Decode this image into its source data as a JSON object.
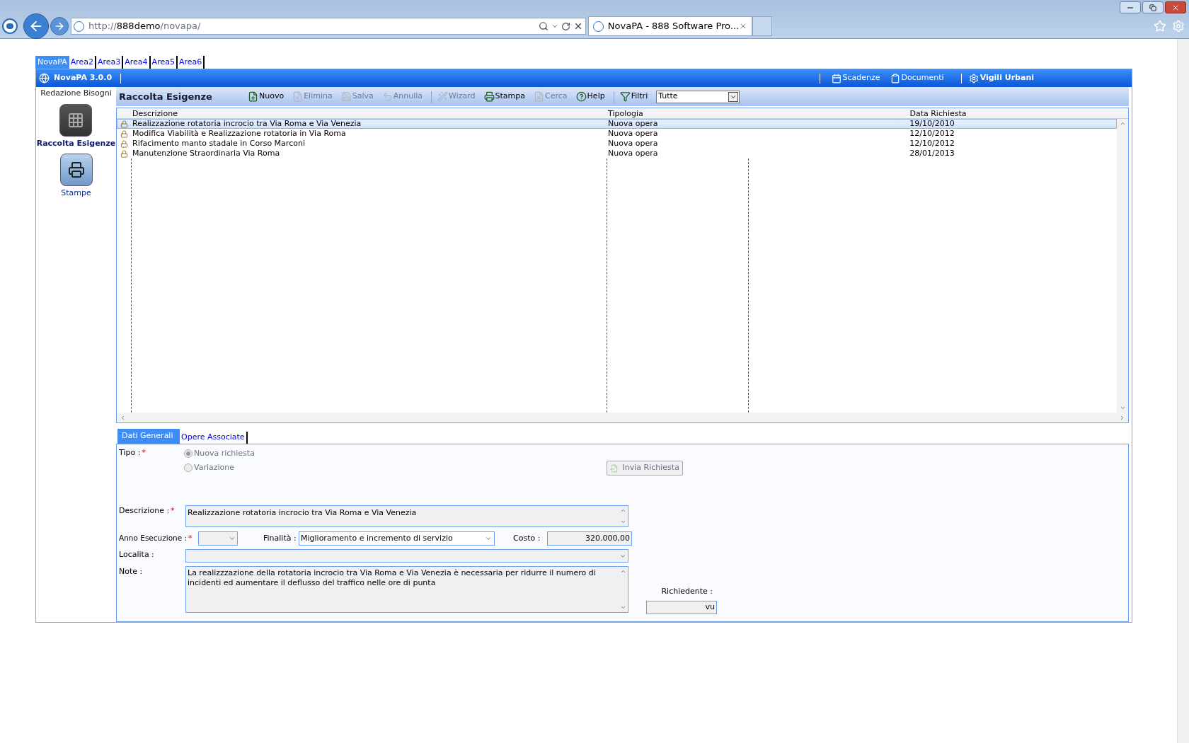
{
  "browser": {
    "url_scheme": "http://",
    "url_host": "888demo",
    "url_path": "/novapa/",
    "tab_title": "NovaPA - 888 Software Pro..."
  },
  "area_tabs": [
    {
      "label": "NovaPA",
      "selected": true
    },
    {
      "label": "Area2",
      "selected": false
    },
    {
      "label": "Area3",
      "selected": false
    },
    {
      "label": "Area4",
      "selected": false
    },
    {
      "label": "Area5",
      "selected": false
    },
    {
      "label": "Area6",
      "selected": false
    }
  ],
  "header": {
    "title": "NovaPA 3.0.0",
    "links": [
      {
        "label": "Scadenze",
        "kind": "calendar",
        "emphasized": false
      },
      {
        "label": "Documenti",
        "kind": "clipboard",
        "emphasized": false
      },
      {
        "label": "Vigili Urbani",
        "kind": "gear",
        "emphasized": true
      }
    ]
  },
  "sidebar": {
    "section_title": "Redazione Bisogni",
    "items": [
      {
        "label": "Raccolta Esigenze",
        "kind": "grid",
        "selected": true
      },
      {
        "label": "Stampe",
        "kind": "printer",
        "selected": false
      }
    ]
  },
  "toolbar": {
    "title": "Raccolta Esigenze",
    "buttons": [
      {
        "label": "Nuovo",
        "kind": "new",
        "disabled": false,
        "separator_after": false
      },
      {
        "label": "Elimina",
        "kind": "delete",
        "disabled": true,
        "separator_after": false
      },
      {
        "label": "Salva",
        "kind": "save",
        "disabled": true,
        "separator_after": false
      },
      {
        "label": "Annulla",
        "kind": "undo",
        "disabled": true,
        "separator_after": true
      },
      {
        "label": "Wizard",
        "kind": "wizard",
        "disabled": true,
        "separator_after": false
      },
      {
        "label": "Stampa",
        "kind": "print",
        "disabled": false,
        "separator_after": false
      },
      {
        "label": "Cerca",
        "kind": "search",
        "disabled": true,
        "separator_after": false
      },
      {
        "label": "Help",
        "kind": "help",
        "disabled": false,
        "separator_after": true
      },
      {
        "label": "Filtri",
        "kind": "filter",
        "disabled": false,
        "separator_after": false
      }
    ],
    "filter": {
      "value": "Tutte"
    }
  },
  "table": {
    "columns": [
      "Descrizione",
      "Tipologia",
      "Data Richiesta"
    ],
    "rows": [
      {
        "cells": [
          "Realizzazione rotatoria incrocio tra Via Roma e Via Venezia",
          "Nuova opera",
          "19/10/2010"
        ],
        "selected": true
      },
      {
        "cells": [
          "Modifica Viabilità e Realizzazione rotatoria in Via Roma",
          "Nuova opera",
          "12/10/2012"
        ],
        "selected": false
      },
      {
        "cells": [
          "Rifacimento manto stadale in Corso Marconi",
          "Nuova opera",
          "12/10/2012"
        ],
        "selected": false
      },
      {
        "cells": [
          "Manutenzione Straordinaria Via Roma",
          "Nuova opera",
          "28/01/2013"
        ],
        "selected": false
      }
    ]
  },
  "detail_tabs": [
    {
      "label": "Dati Generali",
      "selected": true
    },
    {
      "label": "Opere Associate",
      "selected": false
    }
  ],
  "form": {
    "tipo": {
      "label": "Tipo :",
      "required_mark": "*",
      "options": [
        {
          "label": "Nuova richiesta",
          "selected": true,
          "disabled": true
        },
        {
          "label": "Variazione",
          "selected": false,
          "disabled": true
        }
      ]
    },
    "send_button": {
      "label": "Invia Richiesta",
      "disabled": true
    },
    "descrizione": {
      "label": "Descrizione :",
      "required_mark": "*",
      "value": "Realizzazione rotatoria incrocio tra Via Roma e Via Venezia"
    },
    "anno": {
      "label": "Anno Esecuzione :",
      "required_mark": "*"
    },
    "finalita": {
      "label": "Finalità :",
      "value": "Miglioramento e incremento di servizio"
    },
    "costo": {
      "label": "Costo :",
      "value": "320.000,00"
    },
    "localita": {
      "label": "Localita :"
    },
    "note": {
      "label": "Note :",
      "value": "La realizzzazione della rotatoria incrocio tra Via Roma e Via Venezia è necessaria per ridurre il numero di incidenti ed aumentare il deflusso del traffico nelle ore di punta"
    },
    "richiedente": {
      "label": "Richiedente :",
      "value": "vu"
    }
  }
}
